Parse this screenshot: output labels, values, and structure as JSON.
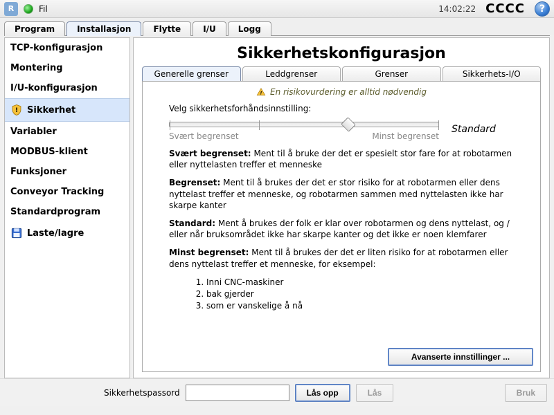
{
  "topbar": {
    "file_label": "Fil",
    "time": "14:02:22",
    "cccc": "CCCC"
  },
  "main_tabs": {
    "program": "Program",
    "installasjon": "Installasjon",
    "flytte": "Flytte",
    "iu": "I/U",
    "logg": "Logg",
    "active": "installasjon"
  },
  "sidebar": {
    "tcp": "TCP-konfigurasjon",
    "montering": "Montering",
    "iu": "I/U-konfigurasjon",
    "sikkerhet": "Sikkerhet",
    "variabler": "Variabler",
    "modbus": "MODBUS-klient",
    "funksjoner": "Funksjoner",
    "conveyor": "Conveyor Tracking",
    "standardprogram": "Standardprogram",
    "laste": "Laste/lagre",
    "selected": "sikkerhet"
  },
  "main": {
    "title": "Sikkerhetskonfigurasjon",
    "subtabs": {
      "generelle": "Generelle grenser",
      "ledd": "Leddgrenser",
      "grenser": "Grenser",
      "sio": "Sikkerhets-I/O",
      "active": "generelle"
    },
    "risk_text": "En risikovurdering er alltid nødvendig",
    "preset_label": "Velg sikkerhetsforhåndsinnstilling:",
    "slider": {
      "left_label": "Svært begrenset",
      "right_label": "Minst begrenset",
      "value_index": 2,
      "positions": 4,
      "current_name": "Standard"
    },
    "desc": {
      "svart_t": "Svært begrenset:",
      "svart_b": "Ment til å bruke der det er spesielt stor fare for at robotarmen eller nyttelasten treffer et menneske",
      "begr_t": "Begrenset:",
      "begr_b": "Ment til å brukes der det er stor risiko for at robotarmen eller dens nyttelast treffer et menneske, og robotarmen sammen med nyttelasten ikke har skarpe kanter",
      "std_t": "Standard:",
      "std_b": "Ment å brukes der folk er klar over robotarmen og dens nyttelast, og / eller når bruksområdet ikke har skarpe kanter og det ikke er noen klemfarer",
      "minst_t": "Minst begrenset:",
      "minst_b": "Ment til å brukes der det er liten risiko for at robotarmen eller dens nyttelast treffer et menneske, for eksempel:",
      "ex1": "Inni CNC-maskiner",
      "ex2": "bak gjerder",
      "ex3": "som er vanskelige å nå"
    },
    "advanced_btn": "Avanserte innstillinger ..."
  },
  "bottom": {
    "pw_label": "Sikkerhetspassord",
    "pw_value": "",
    "unlock": "Lås opp",
    "lock": "Lås",
    "apply": "Bruk",
    "lock_enabled": false,
    "apply_enabled": false
  }
}
